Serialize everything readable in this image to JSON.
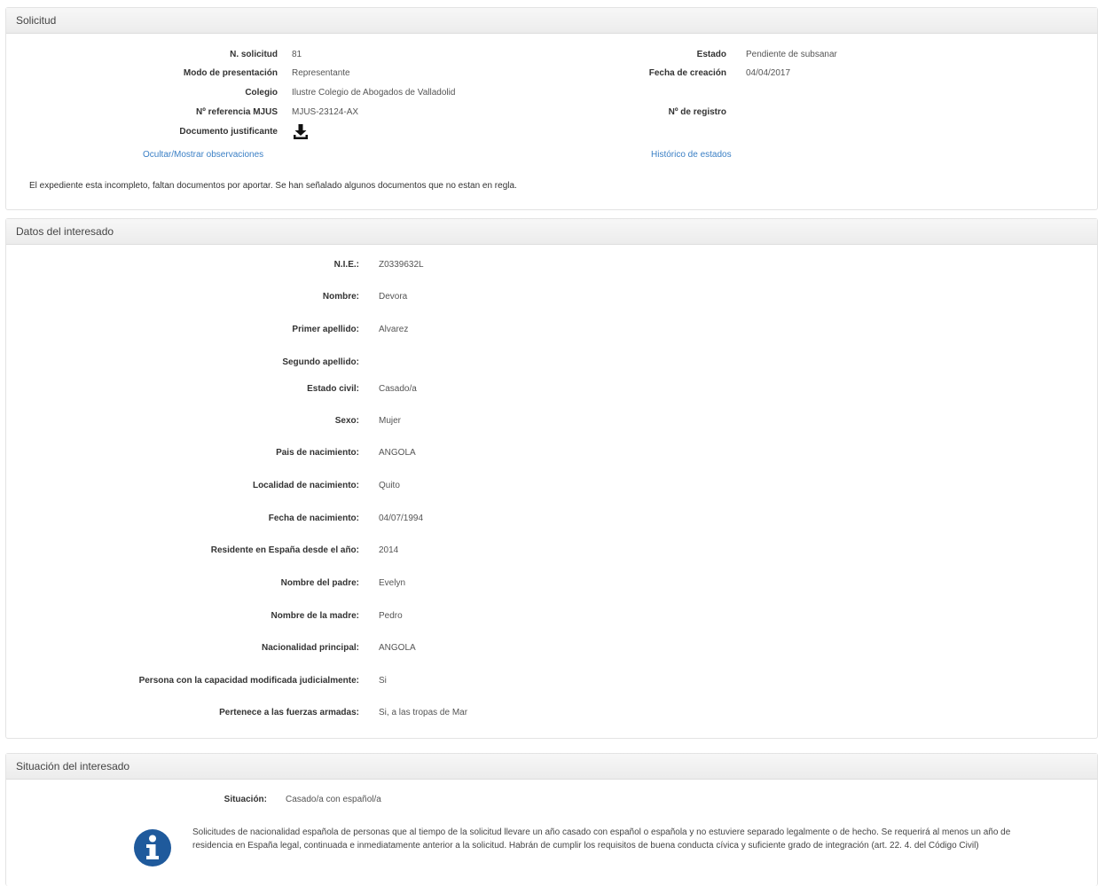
{
  "solicitud": {
    "title": "Solicitud",
    "left": [
      {
        "label": "N. solicitud",
        "value": "81"
      },
      {
        "label": "Modo de presentación",
        "value": "Representante"
      },
      {
        "label": "Colegio",
        "value": "Ilustre Colegio de Abogados de Valladolid"
      },
      {
        "label": "Nº referencia MJUS",
        "value": "MJUS-23124-AX"
      },
      {
        "label": "Documento justificante",
        "value": ""
      }
    ],
    "right": [
      {
        "label": "Estado",
        "value": "Pendiente de subsanar"
      },
      {
        "label": "Fecha de creación",
        "value": "04/04/2017"
      },
      {
        "label": "Nº de registro",
        "value": ""
      }
    ],
    "download_icon": "download-icon",
    "toggle_link": "Ocultar/Mostrar observaciones",
    "history_link": "Histórico de estados",
    "observation": "El expediente esta incompleto, faltan documentos por aportar. Se han señalado algunos documentos que no estan en regla."
  },
  "interesado": {
    "title": "Datos del interesado",
    "fields": [
      {
        "label": "N.I.E.:",
        "value": "Z0339632L"
      },
      {
        "label": "Nombre:",
        "value": "Devora"
      },
      {
        "label": "Primer apellido:",
        "value": "Alvarez"
      },
      {
        "label": "Segundo apellido:",
        "value": ""
      },
      {
        "label": "Estado civil:",
        "value": "Casado/a"
      },
      {
        "label": "Sexo:",
        "value": "Mujer"
      },
      {
        "label": "Pais de nacimiento:",
        "value": "ANGOLA"
      },
      {
        "label": "Localidad de nacimiento:",
        "value": "Quito"
      },
      {
        "label": "Fecha de nacimiento:",
        "value": "04/07/1994"
      },
      {
        "label": "Residente en España desde el año:",
        "value": "2014"
      },
      {
        "label": "Nombre del padre:",
        "value": "Evelyn"
      },
      {
        "label": "Nombre de la madre:",
        "value": "Pedro"
      },
      {
        "label": "Nacionalidad principal:",
        "value": "ANGOLA"
      },
      {
        "label": "Persona con la capacidad modificada judicialmente:",
        "value": "Si"
      },
      {
        "label": "Pertenece a las fuerzas armadas:",
        "value": "Si, a las tropas de Mar"
      }
    ]
  },
  "situacion": {
    "title": "Situación del interesado",
    "label": "Situación:",
    "value": "Casado/a con español/a",
    "info_icon": "info-circle-icon",
    "info_line1": "Solicitudes de nacionalidad española de personas que al tiempo de la solicitud llevare un año casado con español o española y no estuviere separado legalmente o de hecho. Se requerirá al menos un año de",
    "info_line2": "residencia en España legal, continuada e inmediatamente anterior a la solicitud. Habrán de cumplir los requisitos de buena conducta cívica y suficiente grado de integración (art. 22. 4. del Código Civil)"
  }
}
